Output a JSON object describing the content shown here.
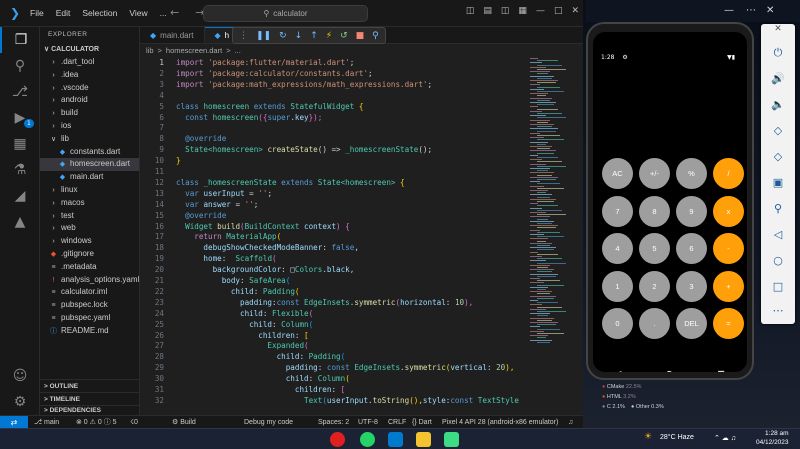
{
  "titlebar": {
    "menus": [
      "File",
      "Edit",
      "Selection",
      "View",
      "..."
    ],
    "search": "calculator"
  },
  "explorer": {
    "header": "EXPLORER",
    "root": "CALCULATOR",
    "items": [
      {
        "label": ".dart_tool",
        "type": "folder",
        "depth": 1
      },
      {
        "label": ".idea",
        "type": "folder",
        "depth": 1
      },
      {
        "label": ".vscode",
        "type": "folder",
        "depth": 1
      },
      {
        "label": "android",
        "type": "folder",
        "depth": 1
      },
      {
        "label": "build",
        "type": "folder",
        "depth": 1
      },
      {
        "label": "ios",
        "type": "folder",
        "depth": 1
      },
      {
        "label": "lib",
        "type": "folder-open",
        "depth": 1
      },
      {
        "label": "constants.dart",
        "type": "dart",
        "depth": 2
      },
      {
        "label": "homescreen.dart",
        "type": "dart",
        "depth": 2,
        "selected": true
      },
      {
        "label": "main.dart",
        "type": "dart",
        "depth": 2
      },
      {
        "label": "linux",
        "type": "folder",
        "depth": 1
      },
      {
        "label": "macos",
        "type": "folder",
        "depth": 1
      },
      {
        "label": "test",
        "type": "folder",
        "depth": 1
      },
      {
        "label": "web",
        "type": "folder",
        "depth": 1
      },
      {
        "label": "windows",
        "type": "folder",
        "depth": 1
      },
      {
        "label": ".gitignore",
        "type": "git",
        "depth": 1
      },
      {
        "label": ".metadata",
        "type": "file",
        "depth": 1
      },
      {
        "label": "analysis_options.yaml",
        "type": "yaml",
        "depth": 1
      },
      {
        "label": "calculator.iml",
        "type": "file",
        "depth": 1
      },
      {
        "label": "pubspec.lock",
        "type": "file",
        "depth": 1
      },
      {
        "label": "pubspec.yaml",
        "type": "file",
        "depth": 1
      },
      {
        "label": "README.md",
        "type": "info",
        "depth": 1
      }
    ],
    "sections": [
      "OUTLINE",
      "TIMELINE",
      "DEPENDENCIES"
    ]
  },
  "tabs": [
    {
      "label": "main.dart",
      "active": false
    },
    {
      "label": "h",
      "active": true
    }
  ],
  "breadcrumb": [
    "lib",
    ">",
    "homescreen.dart",
    ">",
    "..."
  ],
  "code": [
    [
      {
        "t": "import ",
        "c": "#c586c0"
      },
      {
        "t": "'package:flutter/material.dart'",
        "c": "#ce9178"
      },
      {
        "t": ";",
        "c": "#d4d4d4"
      }
    ],
    [
      {
        "t": "import ",
        "c": "#c586c0"
      },
      {
        "t": "'package:calculator/constants.dart'",
        "c": "#ce9178"
      },
      {
        "t": ";",
        "c": "#d4d4d4"
      }
    ],
    [
      {
        "t": "import ",
        "c": "#c586c0"
      },
      {
        "t": "'package:math_expressions/math_expressions.dart'",
        "c": "#ce9178"
      },
      {
        "t": ";",
        "c": "#d4d4d4"
      }
    ],
    [],
    [
      {
        "t": "class ",
        "c": "#569cd6"
      },
      {
        "t": "homescreen ",
        "c": "#4ec9b0"
      },
      {
        "t": "extends ",
        "c": "#569cd6"
      },
      {
        "t": "StatefulWidget ",
        "c": "#4ec9b0"
      },
      {
        "t": "{",
        "c": "#ffd700"
      }
    ],
    [
      {
        "t": "  const ",
        "c": "#569cd6"
      },
      {
        "t": "homescreen",
        "c": "#4ec9b0"
      },
      {
        "t": "({",
        "c": "#da70d6"
      },
      {
        "t": "super",
        "c": "#569cd6"
      },
      {
        "t": ".key",
        "c": "#9cdcfe"
      },
      {
        "t": "});",
        "c": "#da70d6"
      }
    ],
    [],
    [
      {
        "t": "  @override",
        "c": "#569cd6"
      }
    ],
    [
      {
        "t": "  State",
        "c": "#4ec9b0"
      },
      {
        "t": "<homescreen> ",
        "c": "#4ec9b0"
      },
      {
        "t": "createState",
        "c": "#dcdcaa"
      },
      {
        "t": "() => ",
        "c": "#d4d4d4"
      },
      {
        "t": "_homescreenState",
        "c": "#4ec9b0"
      },
      {
        "t": "();",
        "c": "#d4d4d4"
      }
    ],
    [
      {
        "t": "}",
        "c": "#ffd700"
      }
    ],
    [],
    [
      {
        "t": "class ",
        "c": "#569cd6"
      },
      {
        "t": "_homescreenState ",
        "c": "#4ec9b0"
      },
      {
        "t": "extends ",
        "c": "#569cd6"
      },
      {
        "t": "State",
        "c": "#4ec9b0"
      },
      {
        "t": "<homescreen> ",
        "c": "#4ec9b0"
      },
      {
        "t": "{",
        "c": "#ffd700"
      }
    ],
    [
      {
        "t": "  var ",
        "c": "#569cd6"
      },
      {
        "t": "userInput ",
        "c": "#9cdcfe"
      },
      {
        "t": "= ",
        "c": "#d4d4d4"
      },
      {
        "t": "''",
        "c": "#ce9178"
      },
      {
        "t": ";",
        "c": "#d4d4d4"
      }
    ],
    [
      {
        "t": "  var ",
        "c": "#569cd6"
      },
      {
        "t": "answer ",
        "c": "#9cdcfe"
      },
      {
        "t": "= ",
        "c": "#d4d4d4"
      },
      {
        "t": "''",
        "c": "#ce9178"
      },
      {
        "t": ";",
        "c": "#d4d4d4"
      }
    ],
    [
      {
        "t": "  @override",
        "c": "#569cd6"
      }
    ],
    [
      {
        "t": "  Widget ",
        "c": "#4ec9b0"
      },
      {
        "t": "build",
        "c": "#dcdcaa"
      },
      {
        "t": "(",
        "c": "#da70d6"
      },
      {
        "t": "BuildContext ",
        "c": "#4ec9b0"
      },
      {
        "t": "context",
        "c": "#9cdcfe"
      },
      {
        "t": ") {",
        "c": "#da70d6"
      }
    ],
    [
      {
        "t": "    return ",
        "c": "#c586c0"
      },
      {
        "t": "MaterialApp",
        "c": "#4ec9b0"
      },
      {
        "t": "(",
        "c": "#ffd700"
      }
    ],
    [
      {
        "t": "      debugShowCheckedModeBanner",
        "c": "#9cdcfe"
      },
      {
        "t": ": ",
        "c": "#d4d4d4"
      },
      {
        "t": "false",
        "c": "#569cd6"
      },
      {
        "t": ",",
        "c": "#d4d4d4"
      }
    ],
    [
      {
        "t": "      home",
        "c": "#9cdcfe"
      },
      {
        "t": ":  ",
        "c": "#d4d4d4"
      },
      {
        "t": "Scaffold",
        "c": "#4ec9b0"
      },
      {
        "t": "(",
        "c": "#da70d6"
      }
    ],
    [
      {
        "t": "        backgroundColor",
        "c": "#9cdcfe"
      },
      {
        "t": ": □",
        "c": "#d4d4d4"
      },
      {
        "t": "Colors",
        "c": "#4ec9b0"
      },
      {
        "t": ".black",
        "c": "#9cdcfe"
      },
      {
        "t": ",",
        "c": "#d4d4d4"
      }
    ],
    [
      {
        "t": "          body",
        "c": "#9cdcfe"
      },
      {
        "t": ": ",
        "c": "#d4d4d4"
      },
      {
        "t": "SafeArea",
        "c": "#4ec9b0"
      },
      {
        "t": "(",
        "c": "#179fff"
      }
    ],
    [
      {
        "t": "            child",
        "c": "#9cdcfe"
      },
      {
        "t": ": ",
        "c": "#d4d4d4"
      },
      {
        "t": "Padding",
        "c": "#4ec9b0"
      },
      {
        "t": "(",
        "c": "#ffd700"
      }
    ],
    [
      {
        "t": "              padding",
        "c": "#9cdcfe"
      },
      {
        "t": ":",
        "c": "#d4d4d4"
      },
      {
        "t": "const ",
        "c": "#569cd6"
      },
      {
        "t": "EdgeInsets",
        "c": "#4ec9b0"
      },
      {
        "t": ".",
        "c": "#d4d4d4"
      },
      {
        "t": "symmetric",
        "c": "#dcdcaa"
      },
      {
        "t": "(",
        "c": "#da70d6"
      },
      {
        "t": "horizontal",
        "c": "#9cdcfe"
      },
      {
        "t": ": ",
        "c": "#d4d4d4"
      },
      {
        "t": "10",
        "c": "#b5cea8"
      },
      {
        "t": "),",
        "c": "#da70d6"
      }
    ],
    [
      {
        "t": "              child",
        "c": "#9cdcfe"
      },
      {
        "t": ": ",
        "c": "#d4d4d4"
      },
      {
        "t": "Flexible",
        "c": "#4ec9b0"
      },
      {
        "t": "(",
        "c": "#da70d6"
      }
    ],
    [
      {
        "t": "                child",
        "c": "#9cdcfe"
      },
      {
        "t": ": ",
        "c": "#d4d4d4"
      },
      {
        "t": "Column",
        "c": "#4ec9b0"
      },
      {
        "t": "(",
        "c": "#179fff"
      }
    ],
    [
      {
        "t": "                  children",
        "c": "#9cdcfe"
      },
      {
        "t": ": ",
        "c": "#d4d4d4"
      },
      {
        "t": "[",
        "c": "#ffd700"
      }
    ],
    [
      {
        "t": "                    Expanded",
        "c": "#4ec9b0"
      },
      {
        "t": "(",
        "c": "#da70d6"
      }
    ],
    [
      {
        "t": "                      child",
        "c": "#9cdcfe"
      },
      {
        "t": ": ",
        "c": "#d4d4d4"
      },
      {
        "t": "Padding",
        "c": "#4ec9b0"
      },
      {
        "t": "(",
        "c": "#179fff"
      }
    ],
    [
      {
        "t": "                        padding",
        "c": "#9cdcfe"
      },
      {
        "t": ": ",
        "c": "#d4d4d4"
      },
      {
        "t": "const ",
        "c": "#569cd6"
      },
      {
        "t": "EdgeInsets",
        "c": "#4ec9b0"
      },
      {
        "t": ".",
        "c": "#d4d4d4"
      },
      {
        "t": "symmetric",
        "c": "#dcdcaa"
      },
      {
        "t": "(",
        "c": "#ffd700"
      },
      {
        "t": "vertical",
        "c": "#9cdcfe"
      },
      {
        "t": ": ",
        "c": "#d4d4d4"
      },
      {
        "t": "20",
        "c": "#b5cea8"
      },
      {
        "t": "),",
        "c": "#ffd700"
      }
    ],
    [
      {
        "t": "                        child",
        "c": "#9cdcfe"
      },
      {
        "t": ": ",
        "c": "#d4d4d4"
      },
      {
        "t": "Column",
        "c": "#4ec9b0"
      },
      {
        "t": "(",
        "c": "#ffd700"
      }
    ],
    [
      {
        "t": "                          children",
        "c": "#9cdcfe"
      },
      {
        "t": ": ",
        "c": "#d4d4d4"
      },
      {
        "t": "[",
        "c": "#da70d6"
      }
    ],
    [
      {
        "t": "                            Text",
        "c": "#4ec9b0"
      },
      {
        "t": "(",
        "c": "#179fff"
      },
      {
        "t": "userInput",
        "c": "#9cdcfe"
      },
      {
        "t": ".",
        "c": "#d4d4d4"
      },
      {
        "t": "toString",
        "c": "#dcdcaa"
      },
      {
        "t": "(),",
        "c": "#ffd700"
      },
      {
        "t": "style",
        "c": "#9cdcfe"
      },
      {
        "t": ":",
        "c": "#d4d4d4"
      },
      {
        "t": "const ",
        "c": "#569cd6"
      },
      {
        "t": "TextStyle",
        "c": "#4ec9b0"
      }
    ]
  ],
  "statusbar": {
    "branch": "main",
    "problems": "⊗ 0 ⚠ 0 ⓘ 5",
    "ports": "☇0",
    "build": "Build",
    "debug": "Debug my code",
    "spaces": "Spaces: 2",
    "encoding": "UTF-8",
    "eol": "CRLF",
    "lang": "Dart",
    "device": "Pixel 4 API 28 (android-x86 emulator)"
  },
  "phone": {
    "time": "1:28",
    "keys": [
      {
        "label": "AC",
        "style": "gray"
      },
      {
        "label": "+/-",
        "style": "gray"
      },
      {
        "label": "%",
        "style": "gray"
      },
      {
        "label": "/",
        "style": "orange"
      },
      {
        "label": "7",
        "style": "gray"
      },
      {
        "label": "8",
        "style": "gray"
      },
      {
        "label": "9",
        "style": "gray"
      },
      {
        "label": "x",
        "style": "orange"
      },
      {
        "label": "4",
        "style": "gray"
      },
      {
        "label": "5",
        "style": "gray"
      },
      {
        "label": "6",
        "style": "gray"
      },
      {
        "label": "-",
        "style": "orange"
      },
      {
        "label": "1",
        "style": "gray"
      },
      {
        "label": "2",
        "style": "gray"
      },
      {
        "label": "3",
        "style": "gray"
      },
      {
        "label": "+",
        "style": "orange"
      },
      {
        "label": "0",
        "style": "gray"
      },
      {
        "label": ".",
        "style": "gray"
      },
      {
        "label": "DEL",
        "style": "gray"
      },
      {
        "label": "=",
        "style": "orange"
      }
    ],
    "colors": {
      "gray": "#9e9e9e",
      "orange": "#ff9f0a"
    }
  },
  "widget": {
    "line1_label": "CMake",
    "line1_value": "22.5%",
    "line2_label": "HTML",
    "line2_value": "3.2%",
    "line3a": "C 2.1%",
    "line3b": "Other 0.3%"
  },
  "taskbar": {
    "weather": "28°C  Haze",
    "time": "1:28 am",
    "date": "04/12/2023"
  }
}
